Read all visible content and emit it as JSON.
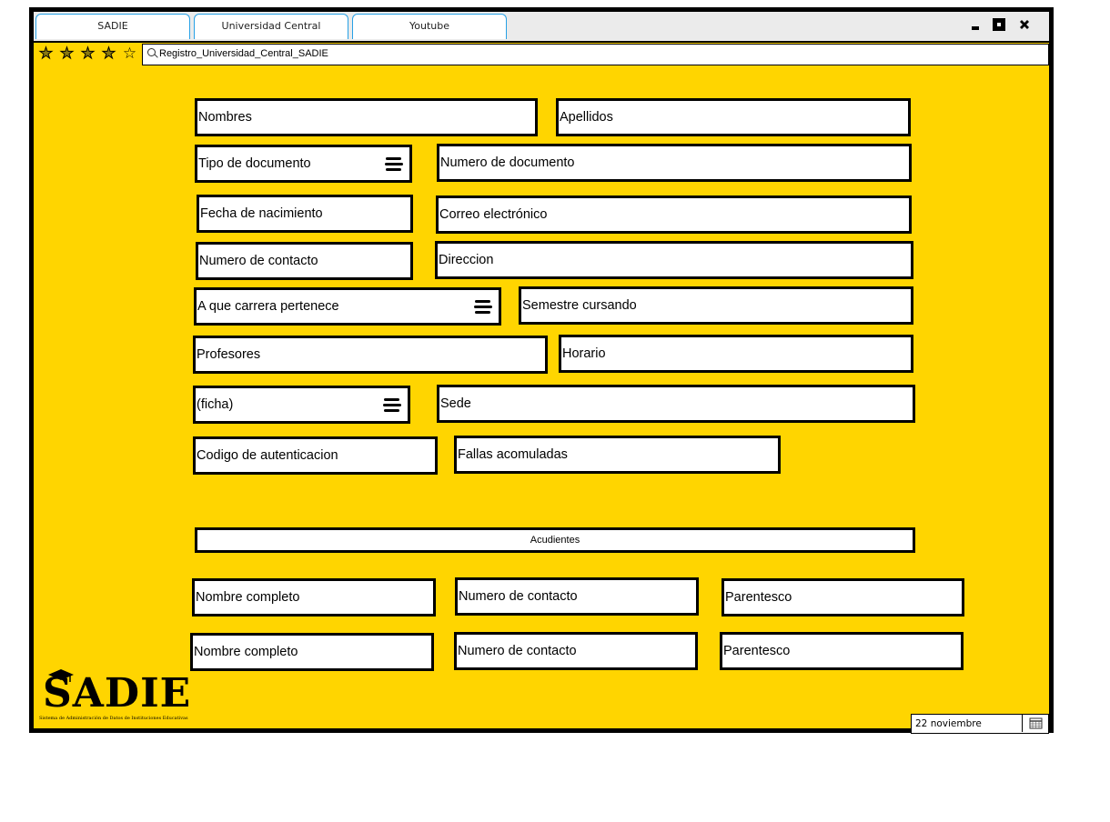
{
  "browser": {
    "tabs": [
      "SADIE",
      "Universidad Central",
      "Youtube"
    ],
    "address": "Registro_Universidad_Central_SADIE",
    "rating": {
      "filled": 4,
      "total": 5
    }
  },
  "form": {
    "nombres": "Nombres",
    "apellidos": "Apellidos",
    "tipo_documento": "Tipo de documento",
    "numero_documento": "Numero de documento",
    "fecha_nacimiento": "Fecha de nacimiento",
    "correo": "Correo electrónico",
    "numero_contacto": "Numero de contacto",
    "direccion": "Direccion",
    "carrera": "A que carrera pertenece",
    "semestre": "Semestre cursando",
    "profesores": "Profesores",
    "horario": "Horario",
    "ficha": "(ficha)",
    "sede": "Sede",
    "codigo": "Codigo de autenticacion",
    "fallas": "Fallas acomuladas"
  },
  "acudientes": {
    "title": "Acudientes",
    "rows": [
      {
        "nombre": "Nombre completo",
        "contacto": "Numero de contacto",
        "parentesco": "Parentesco"
      },
      {
        "nombre": "Nombre completo",
        "contacto": "Numero de contacto",
        "parentesco": "Parentesco"
      }
    ]
  },
  "logo": {
    "text": "SADIE",
    "subtitle": "Sistema de Administración de Datos de Instituciones Educativas"
  },
  "date": "22 noviembre",
  "colors": {
    "background": "#ffd500",
    "tab_border": "#27a1e6"
  }
}
